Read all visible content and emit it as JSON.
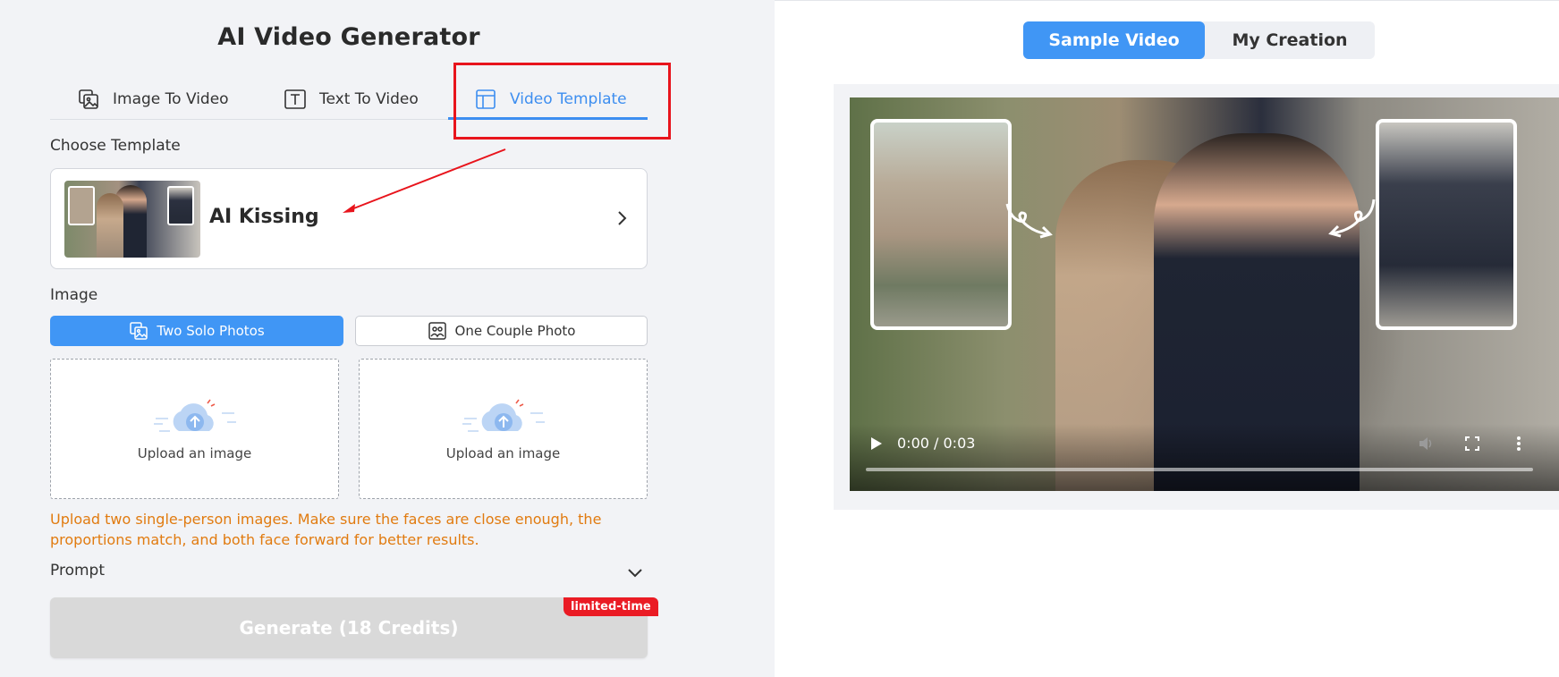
{
  "header": {
    "title": "AI Video Generator"
  },
  "tabs": [
    {
      "label": "Image To Video",
      "icon": "image-to-video-icon"
    },
    {
      "label": "Text To Video",
      "icon": "text-to-video-icon"
    },
    {
      "label": "Video Template",
      "icon": "video-template-icon",
      "active": true
    }
  ],
  "template": {
    "section_label": "Choose Template",
    "selected_name": "AI Kissing"
  },
  "image": {
    "section_label": "Image",
    "modes": [
      {
        "label": "Two Solo Photos",
        "icon": "two-photos-icon",
        "active": true
      },
      {
        "label": "One Couple Photo",
        "icon": "couple-photo-icon",
        "active": false
      }
    ],
    "upload_boxes": [
      {
        "label": "Upload an image"
      },
      {
        "label": "Upload an image"
      }
    ],
    "hint": "Upload two single-person images. Make sure the faces are close enough, the proportions match, and both face forward for better results."
  },
  "prompt": {
    "label": "Prompt"
  },
  "generate": {
    "label": "Generate (18 Credits)",
    "badge": "limited-time"
  },
  "preview": {
    "tabs": [
      {
        "label": "Sample Video",
        "active": true
      },
      {
        "label": "My Creation",
        "active": false
      }
    ],
    "video": {
      "time": "0:00 / 0:03"
    }
  },
  "colors": {
    "accent": "#4096f5",
    "annotation_red": "#e8141c",
    "hint_orange": "#e17b10",
    "badge_red": "#ea1b24",
    "disabled_button": "#d9d9d9"
  }
}
